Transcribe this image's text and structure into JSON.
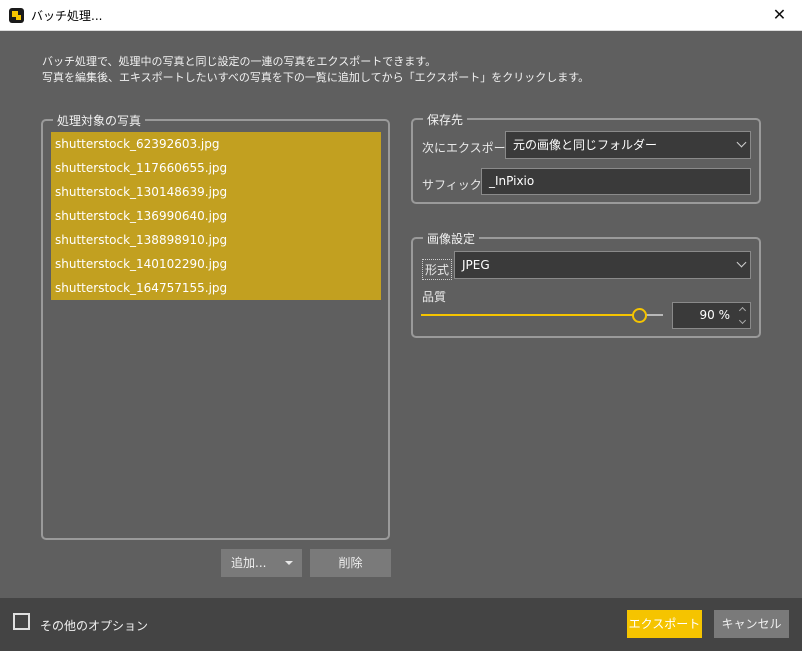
{
  "window": {
    "title": "バッチ処理..."
  },
  "description": [
    "バッチ処理で、処理中の写真と同じ設定の一連の写真をエクスポートできます。",
    "写真を編集後、エキスポートしたいすべの写真を下の一覧に追加してから「エクスポート」をクリックします。"
  ],
  "files_group": {
    "title": "処理対象の写真",
    "files": [
      "shutterstock_62392603.jpg",
      "shutterstock_117660655.jpg",
      "shutterstock_130148639.jpg",
      "shutterstock_136990640.jpg",
      "shutterstock_138898910.jpg",
      "shutterstock_140102290.jpg",
      "shutterstock_164757155.jpg"
    ],
    "add_label": "追加...",
    "delete_label": "削除"
  },
  "destination": {
    "title": "保存先",
    "export_to_label": "次にエクスポート",
    "export_to_value": "元の画像と同じフォルダー",
    "suffix_label": "サフィックス",
    "suffix_value": "_InPixio"
  },
  "image_settings": {
    "title": "画像設定",
    "format_label": "形式",
    "format_value": "JPEG",
    "quality_label": "品質",
    "quality_percent": 90,
    "quality_display": "90 %"
  },
  "footer": {
    "more_options_label": "その他のオプション",
    "more_options_checked": false,
    "export_label": "エクスポート",
    "cancel_label": "キャンセル"
  },
  "colors": {
    "accent": "#f5c400",
    "selection": "#c2a020",
    "background": "#5f5f5f",
    "footer": "#444444"
  },
  "icons": {
    "close": "close-icon",
    "app": "inpixio-app-icon",
    "dropdown": "chevron-down-icon",
    "spinner": "spinner-arrows-icon"
  }
}
